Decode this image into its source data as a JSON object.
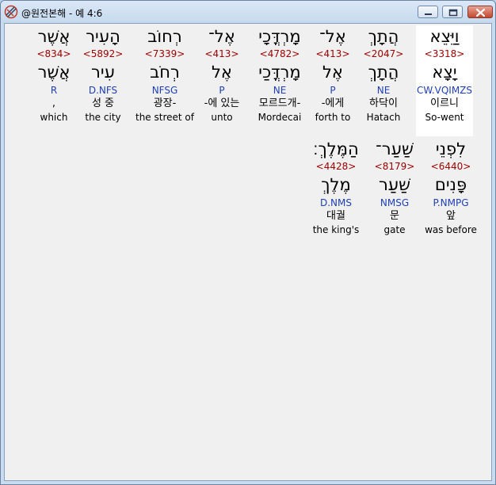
{
  "window": {
    "title": "@원전본해 - 예 4:6",
    "minimize_label": "minimize",
    "maximize_label": "maximize",
    "close_label": "close"
  },
  "lines": [
    {
      "words": [
        {
          "hebrew": "וַיֵּצֵא",
          "strong": "<3318>",
          "lemma": "יָצָא",
          "morph": "CW.VQIMZS",
          "korean": "이르니",
          "gloss": "So-went",
          "highlight": true
        },
        {
          "hebrew": "הֲתָךְ",
          "strong": "<2047>",
          "lemma": "הֲתָךְ",
          "morph": "NE",
          "korean": "하닥이",
          "gloss": "Hatach",
          "highlight": false
        },
        {
          "hebrew": "אֶל־",
          "strong": "<413>",
          "lemma": "אֶל",
          "morph": "P",
          "korean": "-에게",
          "gloss": "forth to",
          "highlight": false
        },
        {
          "hebrew": "מָרְדֳּכָי",
          "strong": "<4782>",
          "lemma": "מָרְדֳּכַי",
          "morph": "NE",
          "korean": "모르드개-",
          "gloss": "Mordecai",
          "highlight": false
        },
        {
          "hebrew": "אֶל־",
          "strong": "<413>",
          "lemma": "אֶל",
          "morph": "P",
          "korean": "-에 있는",
          "gloss": "unto",
          "highlight": false
        },
        {
          "hebrew": "רְחוֹב",
          "strong": "<7339>",
          "lemma": "רְחֹב",
          "morph": "NFSG",
          "korean": "광장-",
          "gloss": "the street of",
          "highlight": false
        },
        {
          "hebrew": "הָעִיר",
          "strong": "<5892>",
          "lemma": "עִיר",
          "morph": "D.NFS",
          "korean": "성 중",
          "gloss": "the city",
          "highlight": false
        },
        {
          "hebrew": "אֲשֶׁר",
          "strong": "<834>",
          "lemma": "אֲשֶׁר",
          "morph": "R",
          "korean": ",",
          "gloss": "which",
          "highlight": false
        }
      ]
    },
    {
      "words": [
        {
          "hebrew": "לִפְנֵי",
          "strong": "<6440>",
          "lemma": "פָּנִים",
          "morph": "P.NMPG",
          "korean": "앞",
          "gloss": "was before",
          "highlight": false
        },
        {
          "hebrew": "שַׁעַר־",
          "strong": "<8179>",
          "lemma": "שַׁעַר",
          "morph": "NMSG",
          "korean": "문",
          "gloss": "gate",
          "highlight": false
        },
        {
          "hebrew": "הַמֶּלֶךְ׃",
          "strong": "<4428>",
          "lemma": "מֶלֶךְ",
          "morph": "D.NMS",
          "korean": "대궐",
          "gloss": "the king's",
          "highlight": false
        }
      ]
    }
  ]
}
